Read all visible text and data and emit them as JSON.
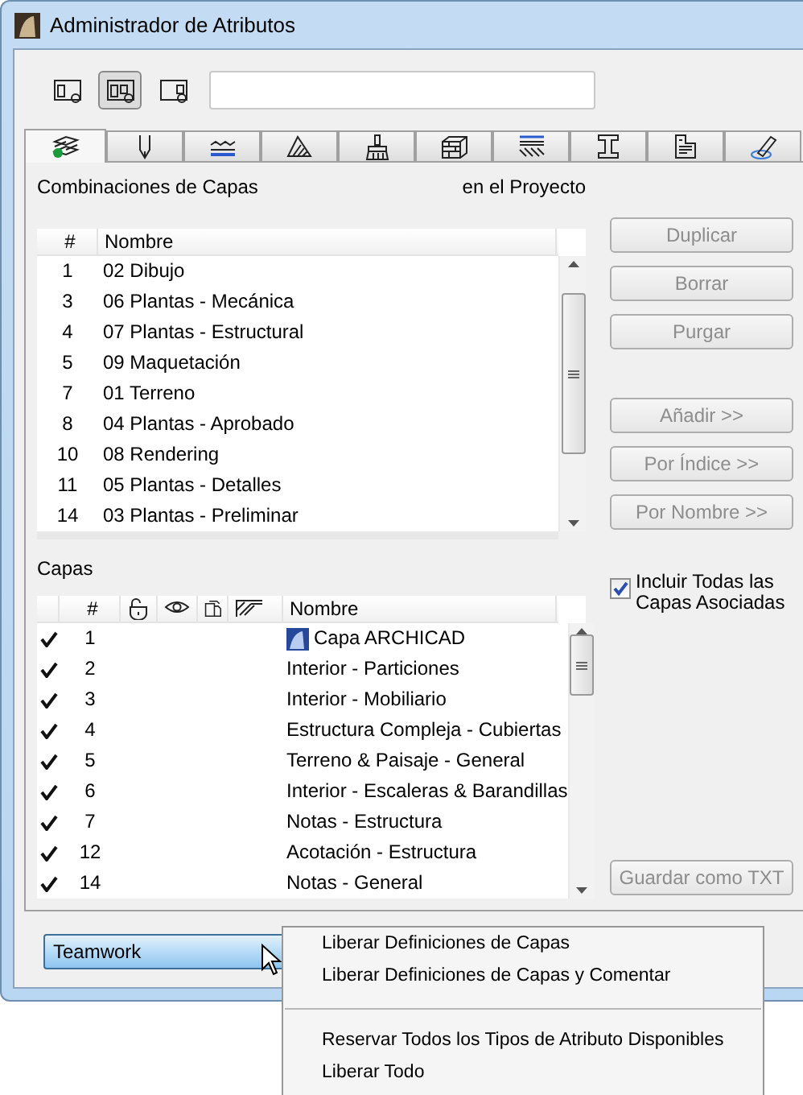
{
  "window": {
    "title": "Administrador de Atributos"
  },
  "view_buttons": [
    {
      "selected": false
    },
    {
      "selected": true
    },
    {
      "selected": false
    }
  ],
  "tabs": [
    {
      "kind": "layers",
      "selected": true
    },
    {
      "kind": "pen",
      "selected": false
    },
    {
      "kind": "line",
      "selected": false
    },
    {
      "kind": "fill",
      "selected": false
    },
    {
      "kind": "brush",
      "selected": false
    },
    {
      "kind": "composite",
      "selected": false
    },
    {
      "kind": "surface",
      "selected": false
    },
    {
      "kind": "profile",
      "selected": false
    },
    {
      "kind": "zone",
      "selected": false
    },
    {
      "kind": "markup",
      "selected": false
    }
  ],
  "combinations": {
    "title": "Combinaciones de Capas",
    "scope": "en el Proyecto",
    "columns": [
      "#",
      "Nombre"
    ],
    "rows": [
      [
        "1",
        "02 Dibujo"
      ],
      [
        "3",
        "06 Plantas - Mecánica"
      ],
      [
        "4",
        "07 Plantas - Estructural"
      ],
      [
        "5",
        "09 Maquetación"
      ],
      [
        "7",
        "01 Terreno"
      ],
      [
        "8",
        "04 Plantas - Aprobado"
      ],
      [
        "10",
        "08 Rendering"
      ],
      [
        "11",
        "05 Plantas - Detalles"
      ],
      [
        "14",
        "03 Plantas - Preliminar"
      ]
    ]
  },
  "button_groups": [
    [
      {
        "label": "Duplicar",
        "disabled": true
      },
      {
        "label": "Borrar",
        "disabled": true
      },
      {
        "label": "Purgar",
        "disabled": true
      }
    ],
    [
      {
        "label": "Añadir >>",
        "disabled": true
      },
      {
        "label": "Por Índice >>",
        "disabled": true
      },
      {
        "label": "Por Nombre >>",
        "disabled": true
      }
    ]
  ],
  "layers": {
    "title": "Capas",
    "columns": [
      {
        "kind": "blank"
      },
      {
        "kind": "text",
        "label": "#"
      },
      {
        "kind": "lock"
      },
      {
        "kind": "eye"
      },
      {
        "kind": "layer"
      },
      {
        "kind": "hatch"
      },
      {
        "kind": "text",
        "label": "Nombre"
      }
    ],
    "rows": [
      {
        "checked": true,
        "number": "1",
        "name": "Capa ARCHICAD",
        "kind": "archicad"
      },
      {
        "checked": true,
        "number": "2",
        "name": "Interior - Particiones",
        "kind": "plain"
      },
      {
        "checked": true,
        "number": "3",
        "name": "Interior - Mobiliario",
        "kind": "plain"
      },
      {
        "checked": true,
        "number": "4",
        "name": "Estructura Compleja - Cubiertas",
        "kind": "plain"
      },
      {
        "checked": true,
        "number": "5",
        "name": "Terreno & Paisaje - General",
        "kind": "plain"
      },
      {
        "checked": true,
        "number": "6",
        "name": "Interior - Escaleras & Barandillas",
        "kind": "plain"
      },
      {
        "checked": true,
        "number": "7",
        "name": "Notas - Estructura",
        "kind": "plain"
      },
      {
        "checked": true,
        "number": "12",
        "name": "Acotación - Estructura",
        "kind": "plain"
      },
      {
        "checked": true,
        "number": "14",
        "name": "Notas - General",
        "kind": "plain"
      }
    ]
  },
  "include_associated": {
    "label": "Incluir Todas las Capas Asociadas",
    "checked": true
  },
  "save_button": {
    "label": "Guardar como TXT",
    "disabled": true
  },
  "teamwork": {
    "label": "Teamwork"
  },
  "menu": {
    "items": [
      {
        "kind": "item",
        "label": "Liberar Definiciones de Capas"
      },
      {
        "kind": "item",
        "label": "Liberar Definiciones de Capas y Comentar"
      },
      {
        "kind": "separator"
      },
      {
        "kind": "item",
        "label": "Reservar Todos los Tipos de Atributo Disponibles"
      },
      {
        "kind": "item",
        "label": "Liberar Todo"
      }
    ]
  }
}
